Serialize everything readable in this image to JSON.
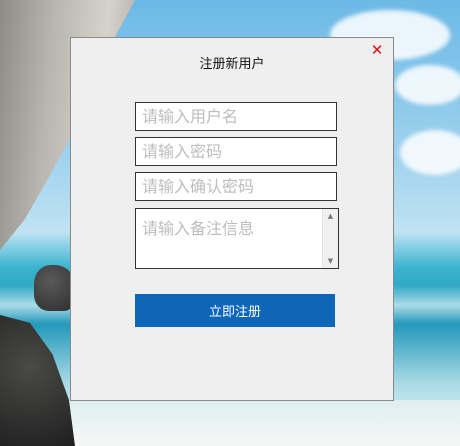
{
  "dialog": {
    "title": "注册新用户",
    "close_glyph": "✕",
    "username_placeholder": "请输入用户名",
    "password_placeholder": "请输入密码",
    "confirm_password_placeholder": "请输入确认密码",
    "remark_placeholder": "请输入备注信息",
    "register_label": "立即注册",
    "colors": {
      "button": "#0e66b9",
      "close": "#e01010",
      "dialog_bg": "#efefef"
    }
  },
  "icons": {
    "close": "close-icon",
    "scroll_up": "scroll-up-arrow-icon",
    "scroll_down": "scroll-down-arrow-icon"
  }
}
